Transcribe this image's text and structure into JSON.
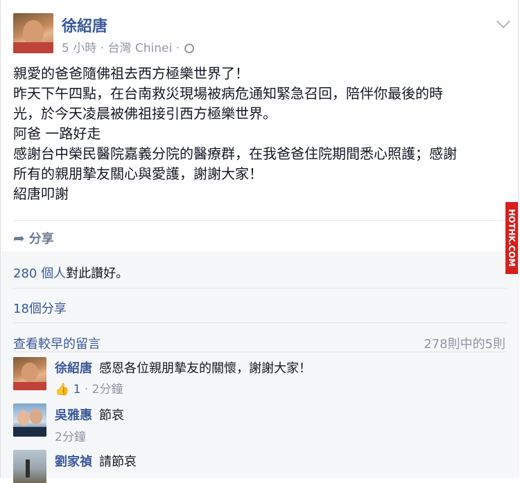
{
  "post": {
    "author": "徐紹唐",
    "time": "5 小時",
    "location": "台灣 Chinei",
    "lines": [
      "親愛的爸爸隨佛祖去西方極樂世界了！",
      "昨天下午四點，在台南救災現場被病危通知緊急召回，陪伴你最後的時",
      "光，於今天凌晨被佛祖接引西方極樂世界。",
      "阿爸 一路好走",
      "感謝台中榮民醫院嘉義分院的醫療群，在我爸爸住院期間悉心照護；感謝",
      "所有的親朋摯友關心與愛護，謝謝大家！",
      "紹唐叩謝"
    ],
    "share_label": "分享"
  },
  "ufi": {
    "likes_count": "280 個人",
    "likes_suffix": "對此讚好。",
    "shares": "18個分享",
    "view_older": "查看較早的留言",
    "comment_count": "278則中的5則"
  },
  "comments": [
    {
      "name": "徐紹唐",
      "text": "感恩各位親朋摯友的關懷，謝謝大家！",
      "likes": "1",
      "time": "2分鐘"
    },
    {
      "name": "吳雅惠",
      "text": "節哀",
      "time": "2分鐘"
    },
    {
      "name": "劉家禎",
      "text": "請節哀",
      "time": ""
    }
  ],
  "watermark": "HOTHK.COM",
  "colors": {
    "link": "#3b5998",
    "meta": "#9197a3",
    "watermark_bg": "#d81e1e"
  }
}
